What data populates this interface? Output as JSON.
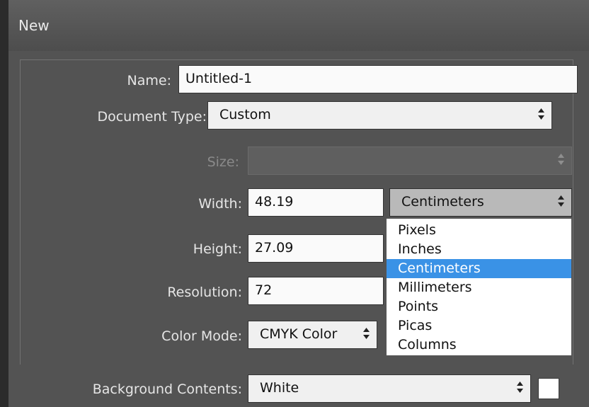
{
  "window": {
    "title": "New"
  },
  "form": {
    "name": {
      "label": "Name:",
      "value": "Untitled-1"
    },
    "document_type": {
      "label": "Document Type:",
      "value": "Custom"
    },
    "size": {
      "label": "Size:",
      "value": ""
    },
    "width": {
      "label": "Width:",
      "value": "48.19",
      "unit": "Centimeters"
    },
    "height": {
      "label": "Height:",
      "value": "27.09"
    },
    "resolution": {
      "label": "Resolution:",
      "value": "72"
    },
    "color_mode": {
      "label": "Color Mode:",
      "value": "CMYK Color"
    },
    "background_contents": {
      "label": "Background Contents:",
      "value": "White",
      "swatch_color": "#ffffff"
    }
  },
  "unit_dropdown": {
    "items": [
      "Pixels",
      "Inches",
      "Centimeters",
      "Millimeters",
      "Points",
      "Picas",
      "Columns"
    ],
    "selected": "Centimeters",
    "highlight_color": "#3a92e6"
  }
}
